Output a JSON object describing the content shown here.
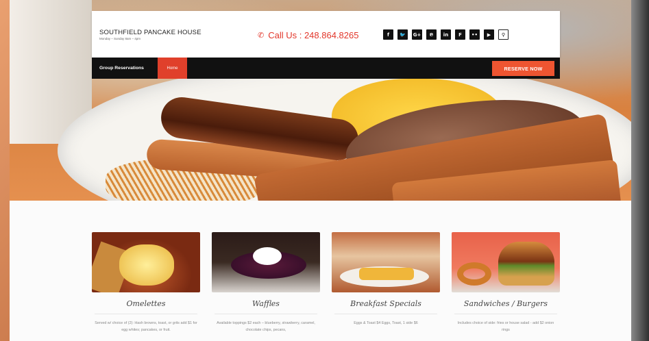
{
  "header": {
    "brand_name": "SOUTHFIELD PANCAKE HOUSE",
    "brand_hours": "Monday – Sunday 8am – 4pm",
    "call_text": "Call Us : 248.864.8265",
    "social": [
      {
        "name": "facebook-icon",
        "glyph": "f"
      },
      {
        "name": "twitter-icon",
        "glyph": "🐦"
      },
      {
        "name": "google-plus-icon",
        "glyph": "G+"
      },
      {
        "name": "pinterest-icon",
        "glyph": "℗"
      },
      {
        "name": "linkedin-icon",
        "glyph": "in"
      },
      {
        "name": "foursquare-icon",
        "glyph": "F"
      },
      {
        "name": "flickr-icon",
        "glyph": "••"
      },
      {
        "name": "youtube-icon",
        "glyph": "▶"
      },
      {
        "name": "search-icon",
        "glyph": "⚲"
      }
    ]
  },
  "nav": {
    "group_reservations": "Group Reservations",
    "home": "Home",
    "reserve": "RESERVE NOW"
  },
  "cards": [
    {
      "title": "Omelettes",
      "desc": "Served w/ choice of (2): Hash browns, toast, or grits add $1 for egg whites; pancakes, or fruit."
    },
    {
      "title": "Waffles",
      "desc": "Available toppings $2 each – blueberry, strawberry, caramel, chocolate chips, pecans,"
    },
    {
      "title": "Breakfast Specials",
      "desc": "Eggs & Toast $4 Eggs, Toast, 1 side $6"
    },
    {
      "title": "Sandwiches / Burgers",
      "desc": "Includes choice of side: fries or house salad - add $2 onion rings"
    }
  ],
  "colors": {
    "accent": "#e0402b",
    "reserve": "#ee5531",
    "call": "#e2362a",
    "nav": "#111111"
  }
}
